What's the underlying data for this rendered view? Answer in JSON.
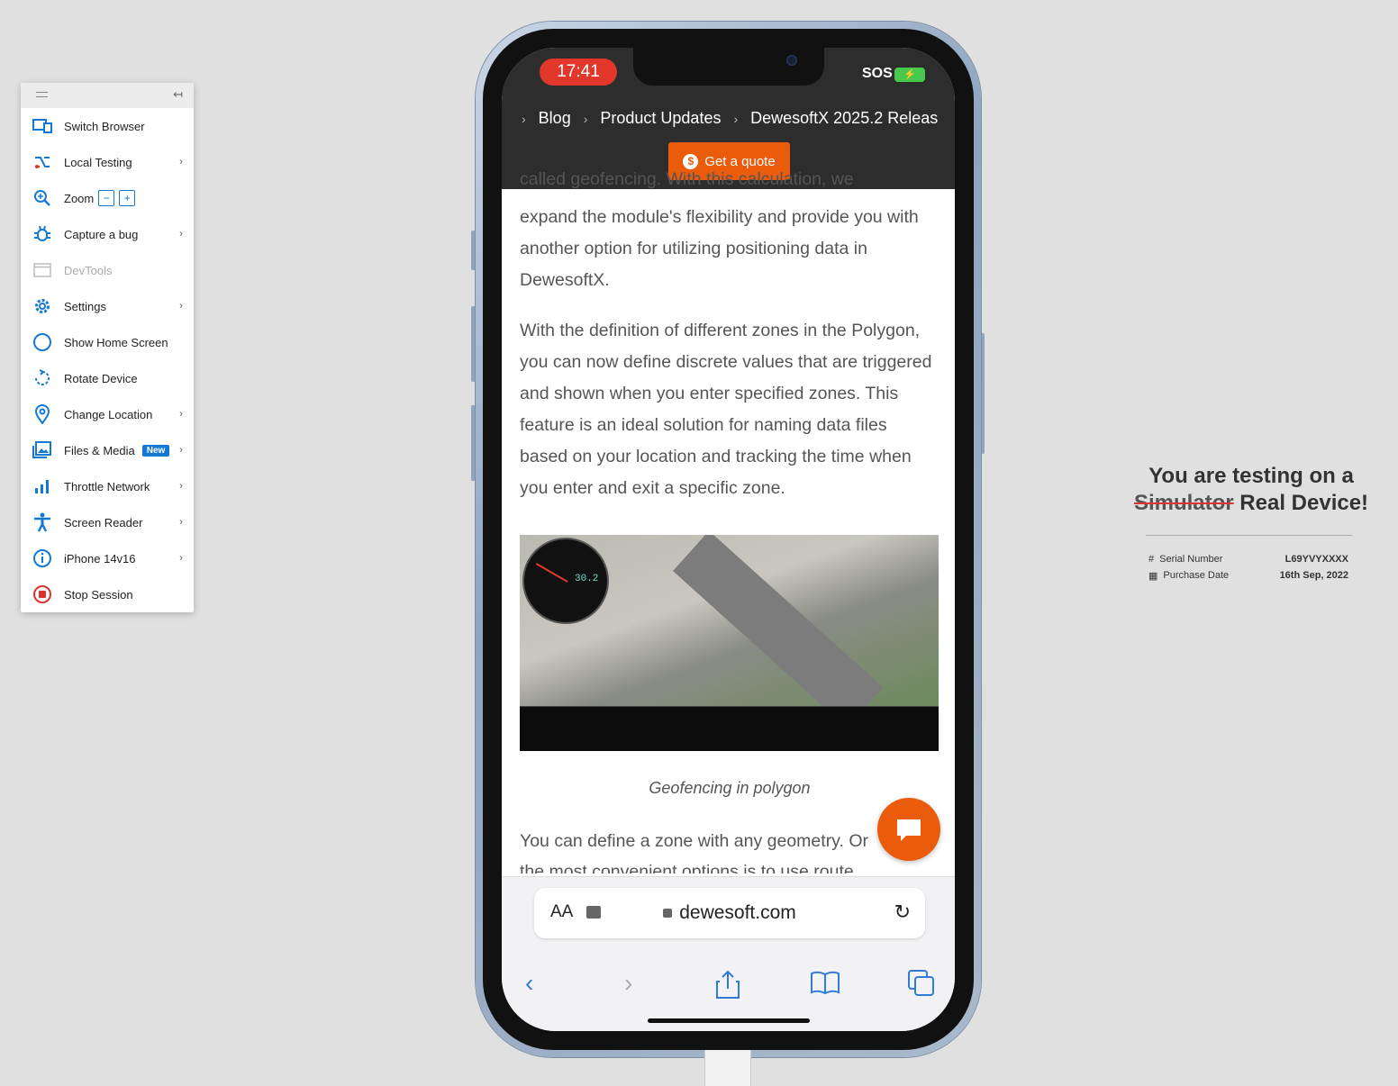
{
  "toolbar": {
    "items": [
      {
        "label": "Switch Browser",
        "icon": "browser-icon"
      },
      {
        "label": "Local Testing",
        "icon": "shuffle-icon"
      },
      {
        "label": "Zoom",
        "icon": "zoom-icon",
        "minus": "−",
        "plus": "+"
      },
      {
        "label": "Capture a bug",
        "icon": "bug-icon"
      },
      {
        "label": "DevTools",
        "icon": "devtools-icon"
      },
      {
        "label": "Settings",
        "icon": "gear-icon"
      },
      {
        "label": "Show Home Screen",
        "icon": "home-circle-icon"
      },
      {
        "label": "Rotate Device",
        "icon": "rotate-icon"
      },
      {
        "label": "Change Location",
        "icon": "location-pin-icon"
      },
      {
        "label": "Files & Media",
        "icon": "image-icon",
        "badge": "New"
      },
      {
        "label": "Throttle Network",
        "icon": "signal-bars-icon"
      },
      {
        "label": "Screen Reader",
        "icon": "accessibility-icon"
      },
      {
        "label": "iPhone 14v16",
        "icon": "info-icon"
      },
      {
        "label": "Stop Session",
        "icon": "stop-icon"
      }
    ],
    "accent_color": "#1479d6"
  },
  "phone": {
    "status": {
      "time": "17:41",
      "sos": "SOS"
    },
    "breadcrumbs": [
      "Blog",
      "Product Updates",
      "DewesoftX 2025.2 Releas"
    ],
    "cta_label": "Get a quote",
    "brand_color": "#ea5b0c",
    "article": {
      "p0_cut": "called geofencing. With this calculation, we",
      "p1": "expand the module's flexibility and provide you with another option for utilizing positioning data in DewesoftX.",
      "p2": "With the definition of different zones in the Polygon, you can now define discrete values that are triggered and shown when you enter specified zones. This feature is an ideal solution for naming data files based on your location and tracking the time when you enter and exit a specific zone.",
      "gauge_value": "30.2",
      "caption": "Geofencing in polygon",
      "p3": "You can define a zone with any geometry. Or",
      "p3_cut": "the most convenient options is to use route"
    },
    "browser": {
      "aa": "AA",
      "url": "dewesoft.com"
    }
  },
  "info": {
    "line1": "You are testing on a",
    "struck": "Simulator",
    "real": "Real Device!",
    "rows": [
      {
        "symbol": "#",
        "key": "Serial Number",
        "value": "L69YVYXXXX"
      },
      {
        "symbol": "▦",
        "key": "Purchase Date",
        "value": "16th Sep, 2022"
      }
    ]
  }
}
